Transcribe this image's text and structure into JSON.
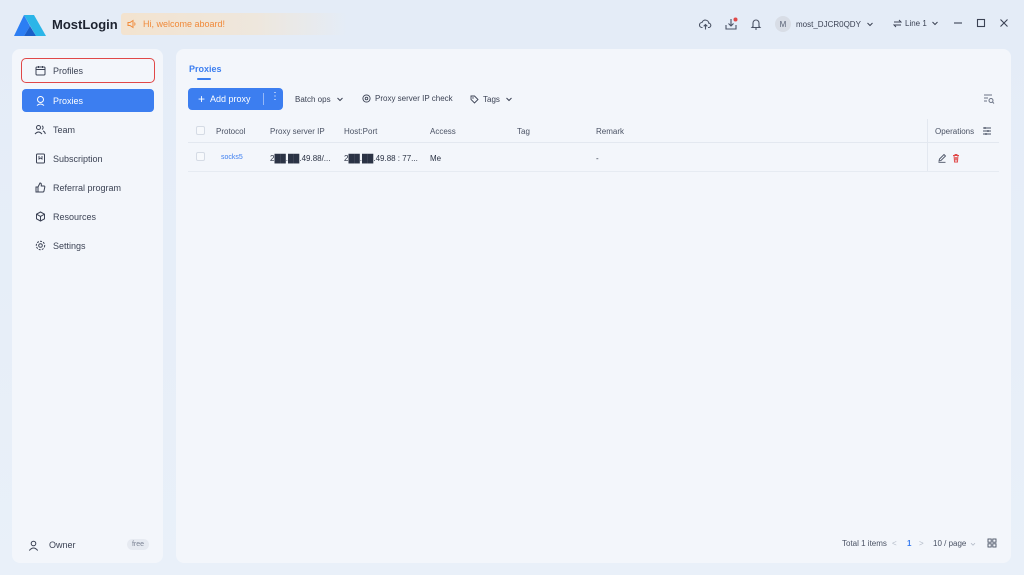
{
  "app": {
    "title": "MostLogin",
    "notice": "Hi, welcome aboard!"
  },
  "user": {
    "avatar_letter": "M",
    "name": "most_DJCR0QDY",
    "line": "Line 1"
  },
  "sidebar": {
    "items": [
      {
        "label": "Profiles",
        "icon": "calendar-icon"
      },
      {
        "label": "Proxies",
        "icon": "proxy-icon"
      },
      {
        "label": "Team",
        "icon": "team-icon"
      },
      {
        "label": "Subscription",
        "icon": "subscription-icon"
      },
      {
        "label": "Referral program",
        "icon": "thumbs-up-icon"
      },
      {
        "label": "Resources",
        "icon": "cube-icon"
      },
      {
        "label": "Settings",
        "icon": "gear-icon"
      }
    ],
    "owner_label": "Owner",
    "plan_badge": "free"
  },
  "main": {
    "tab": "Proxies",
    "add_proxy": "Add proxy",
    "batch_ops": "Batch ops",
    "ip_check": "Proxy server IP check",
    "tags": "Tags"
  },
  "table": {
    "headers": [
      "Protocol",
      "Proxy server IP",
      "Host:Port",
      "Access",
      "Tag",
      "Remark",
      "Operations"
    ],
    "rows": [
      {
        "protocol": "socks5",
        "server_ip": "2██.██.49.88/...",
        "host_port": "2██.██.49.88 : 77...",
        "access": "Me",
        "tag": "",
        "remark": "-"
      }
    ]
  },
  "pagination": {
    "total": "Total 1 items",
    "prev": "<",
    "page": "1",
    "next": ">",
    "per_page": "10 / page"
  },
  "colors": {
    "accent": "#3c7ef0",
    "danger": "#e04848",
    "notice_text": "#f08a3a"
  }
}
